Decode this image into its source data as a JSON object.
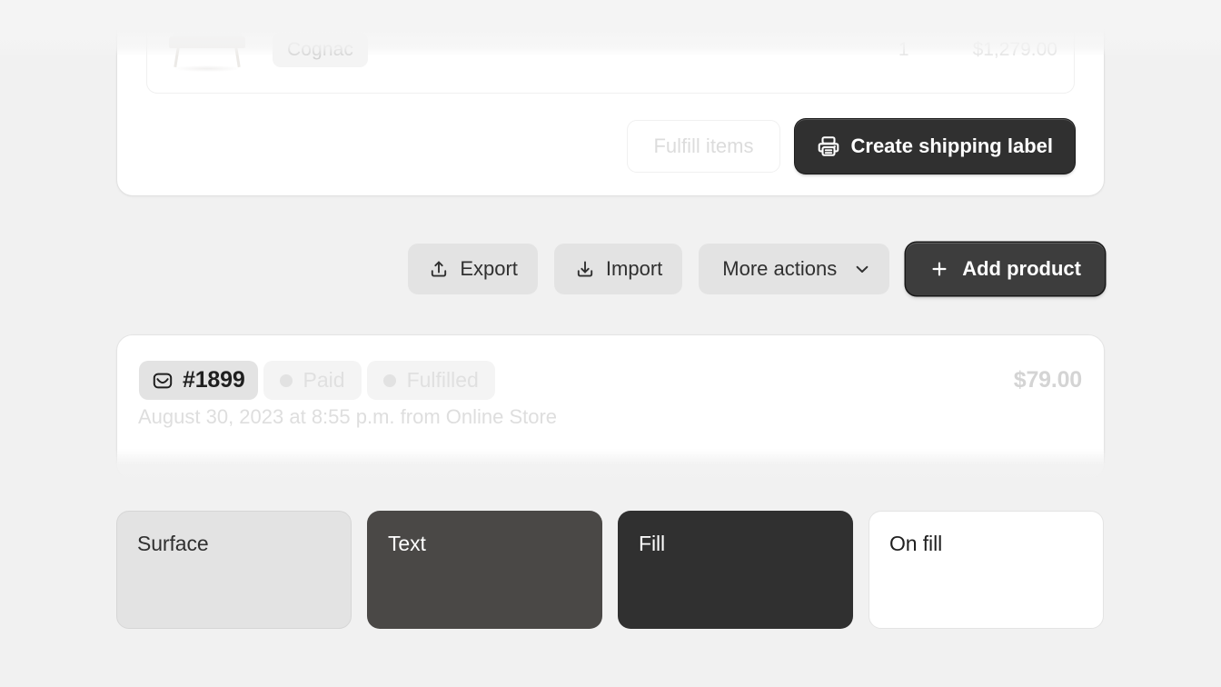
{
  "theme": {
    "page_background": "#f1f1f1",
    "surface": "#e3e3e3",
    "text": "#4a4846",
    "fill": "#303030",
    "on_fill": "#ffffff"
  },
  "order_detail_card": {
    "line_item": {
      "thumbnail_name": "bench-product-image",
      "variant": "Cognac",
      "quantity": "1",
      "price": "$1,279.00"
    },
    "actions": {
      "fulfill_label": "Fulfill items",
      "shipping_label": "Create shipping label",
      "shipping_icon": "printer-icon"
    }
  },
  "toolbar": {
    "export_label": "Export",
    "export_icon": "upload-icon",
    "import_label": "Import",
    "import_icon": "download-icon",
    "more_actions_label": "More actions",
    "more_actions_icon": "chevron-down-icon",
    "add_product_label": "Add product",
    "add_product_icon": "plus-icon"
  },
  "order_card": {
    "order_number": "#1899",
    "order_icon": "order-inbox-icon",
    "payment_status": "Paid",
    "fulfillment_status": "Fulfilled",
    "total": "$79.00",
    "meta": "August 30, 2023 at 8:55 p.m. from Online Store"
  },
  "swatches": [
    {
      "label": "Surface",
      "background": "#e3e3e3",
      "text_color": "#303030",
      "border": "#d6d6d6"
    },
    {
      "label": "Text",
      "background": "#4a4846",
      "text_color": "#ffffff",
      "border": "transparent"
    },
    {
      "label": "Fill",
      "background": "#303030",
      "text_color": "#ffffff",
      "border": "transparent"
    },
    {
      "label": "On fill",
      "background": "#ffffff",
      "text_color": "#1f1f1f",
      "border": "#e4e4e4"
    }
  ]
}
